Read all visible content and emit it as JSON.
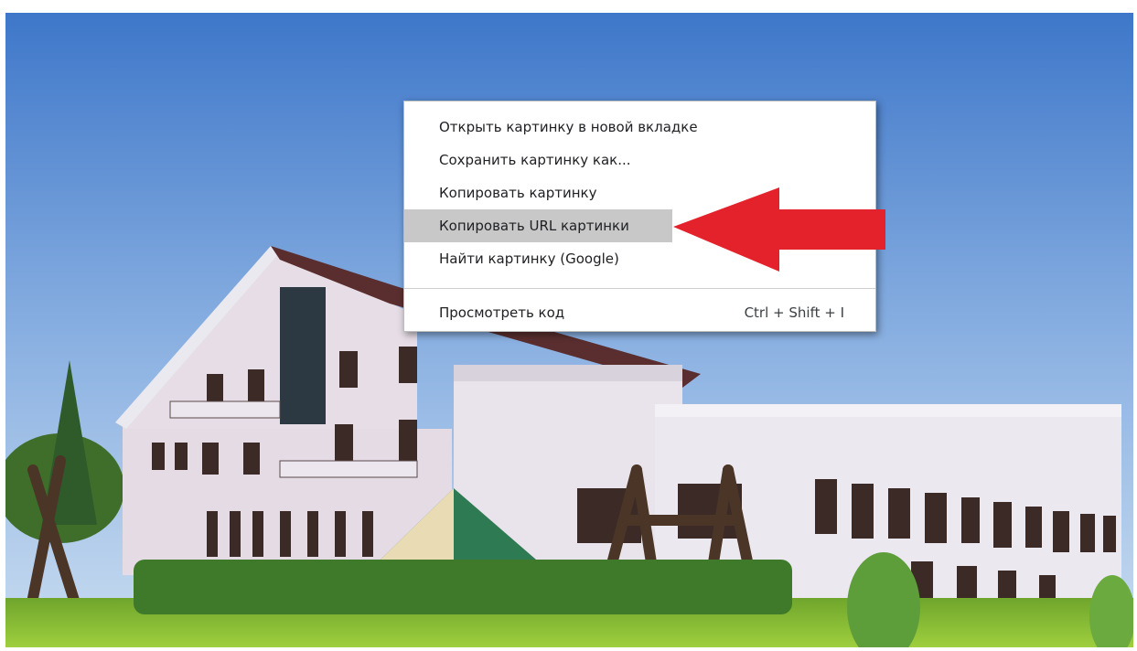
{
  "menu": {
    "items": [
      {
        "label": "Открыть картинку в новой вкладке"
      },
      {
        "label": "Сохранить картинку как..."
      },
      {
        "label": "Копировать картинку"
      },
      {
        "label": "Копировать URL картинки",
        "highlighted": true
      },
      {
        "label": "Найти картинку (Google)"
      }
    ],
    "inspect": {
      "label": "Просмотреть код",
      "shortcut": "Ctrl + Shift + I"
    }
  },
  "colors": {
    "sky_top": "#3e77c9",
    "sky_bottom": "#bcd3ee",
    "arrow": "#e3222b",
    "highlight": "#c8c8c8"
  },
  "icons": {
    "arrow": "red-left-arrow-icon"
  }
}
